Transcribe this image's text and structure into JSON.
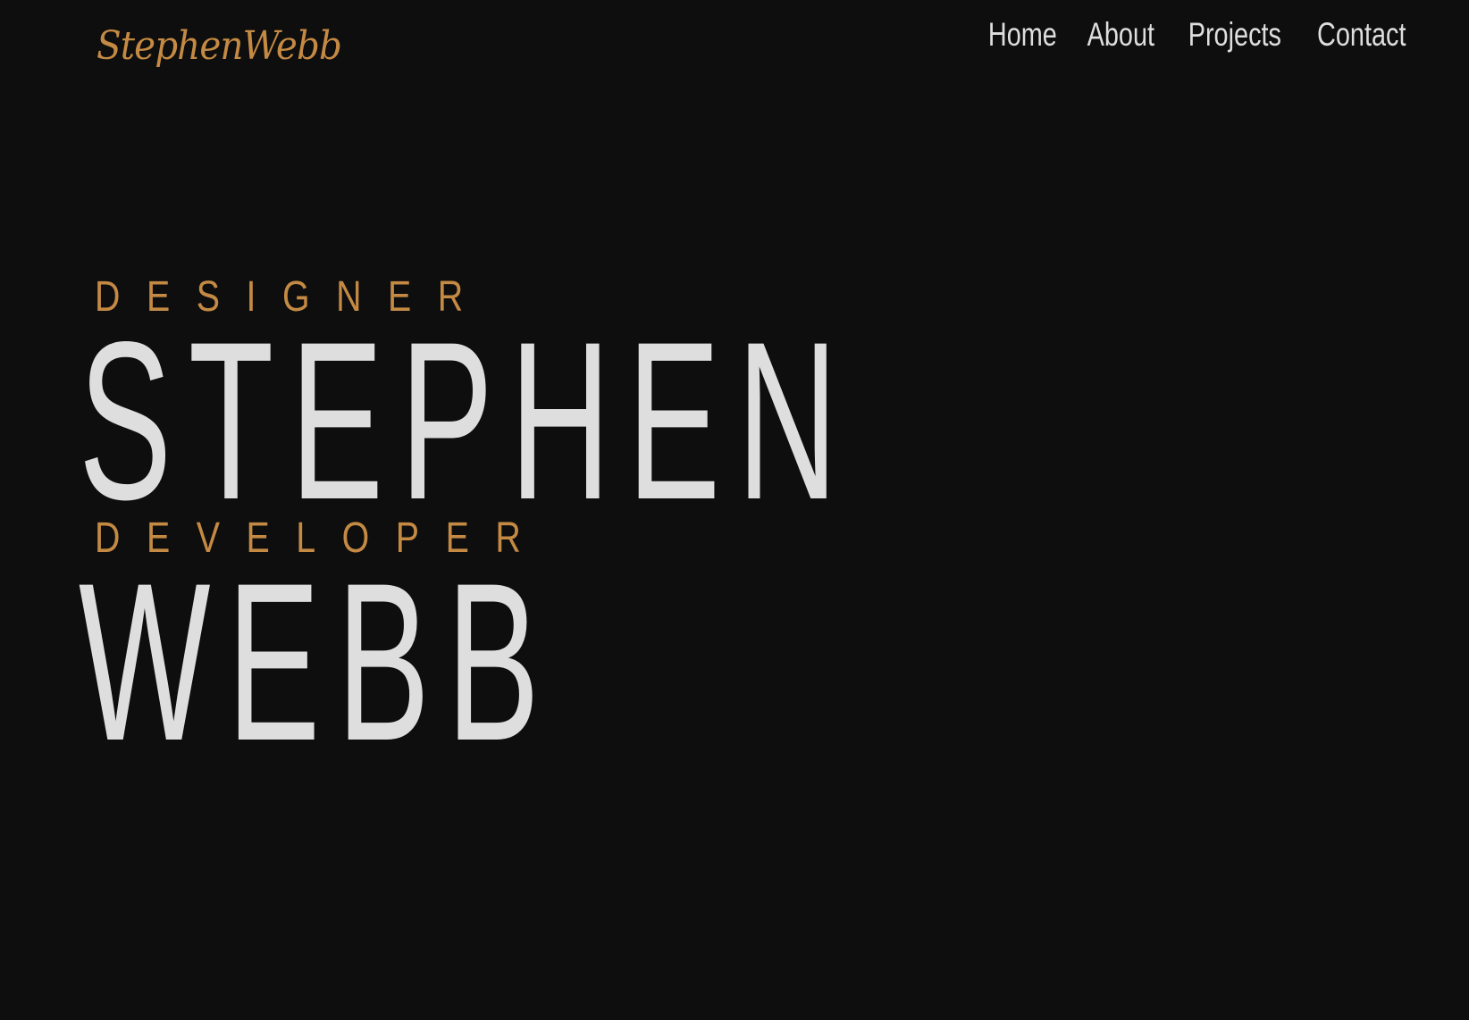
{
  "header": {
    "logo_text": "StephenWebb",
    "nav": [
      {
        "label": "Home"
      },
      {
        "label": "About"
      },
      {
        "label": "Projects"
      },
      {
        "label": "Contact"
      }
    ]
  },
  "hero": {
    "role_1": "DESIGNER",
    "first_name": "STEPHEN",
    "role_2": "DEVELOPER",
    "last_name": "WEBB"
  },
  "colors": {
    "background": "#0e0e0e",
    "accent": "#c48a44",
    "text": "#dedede"
  }
}
